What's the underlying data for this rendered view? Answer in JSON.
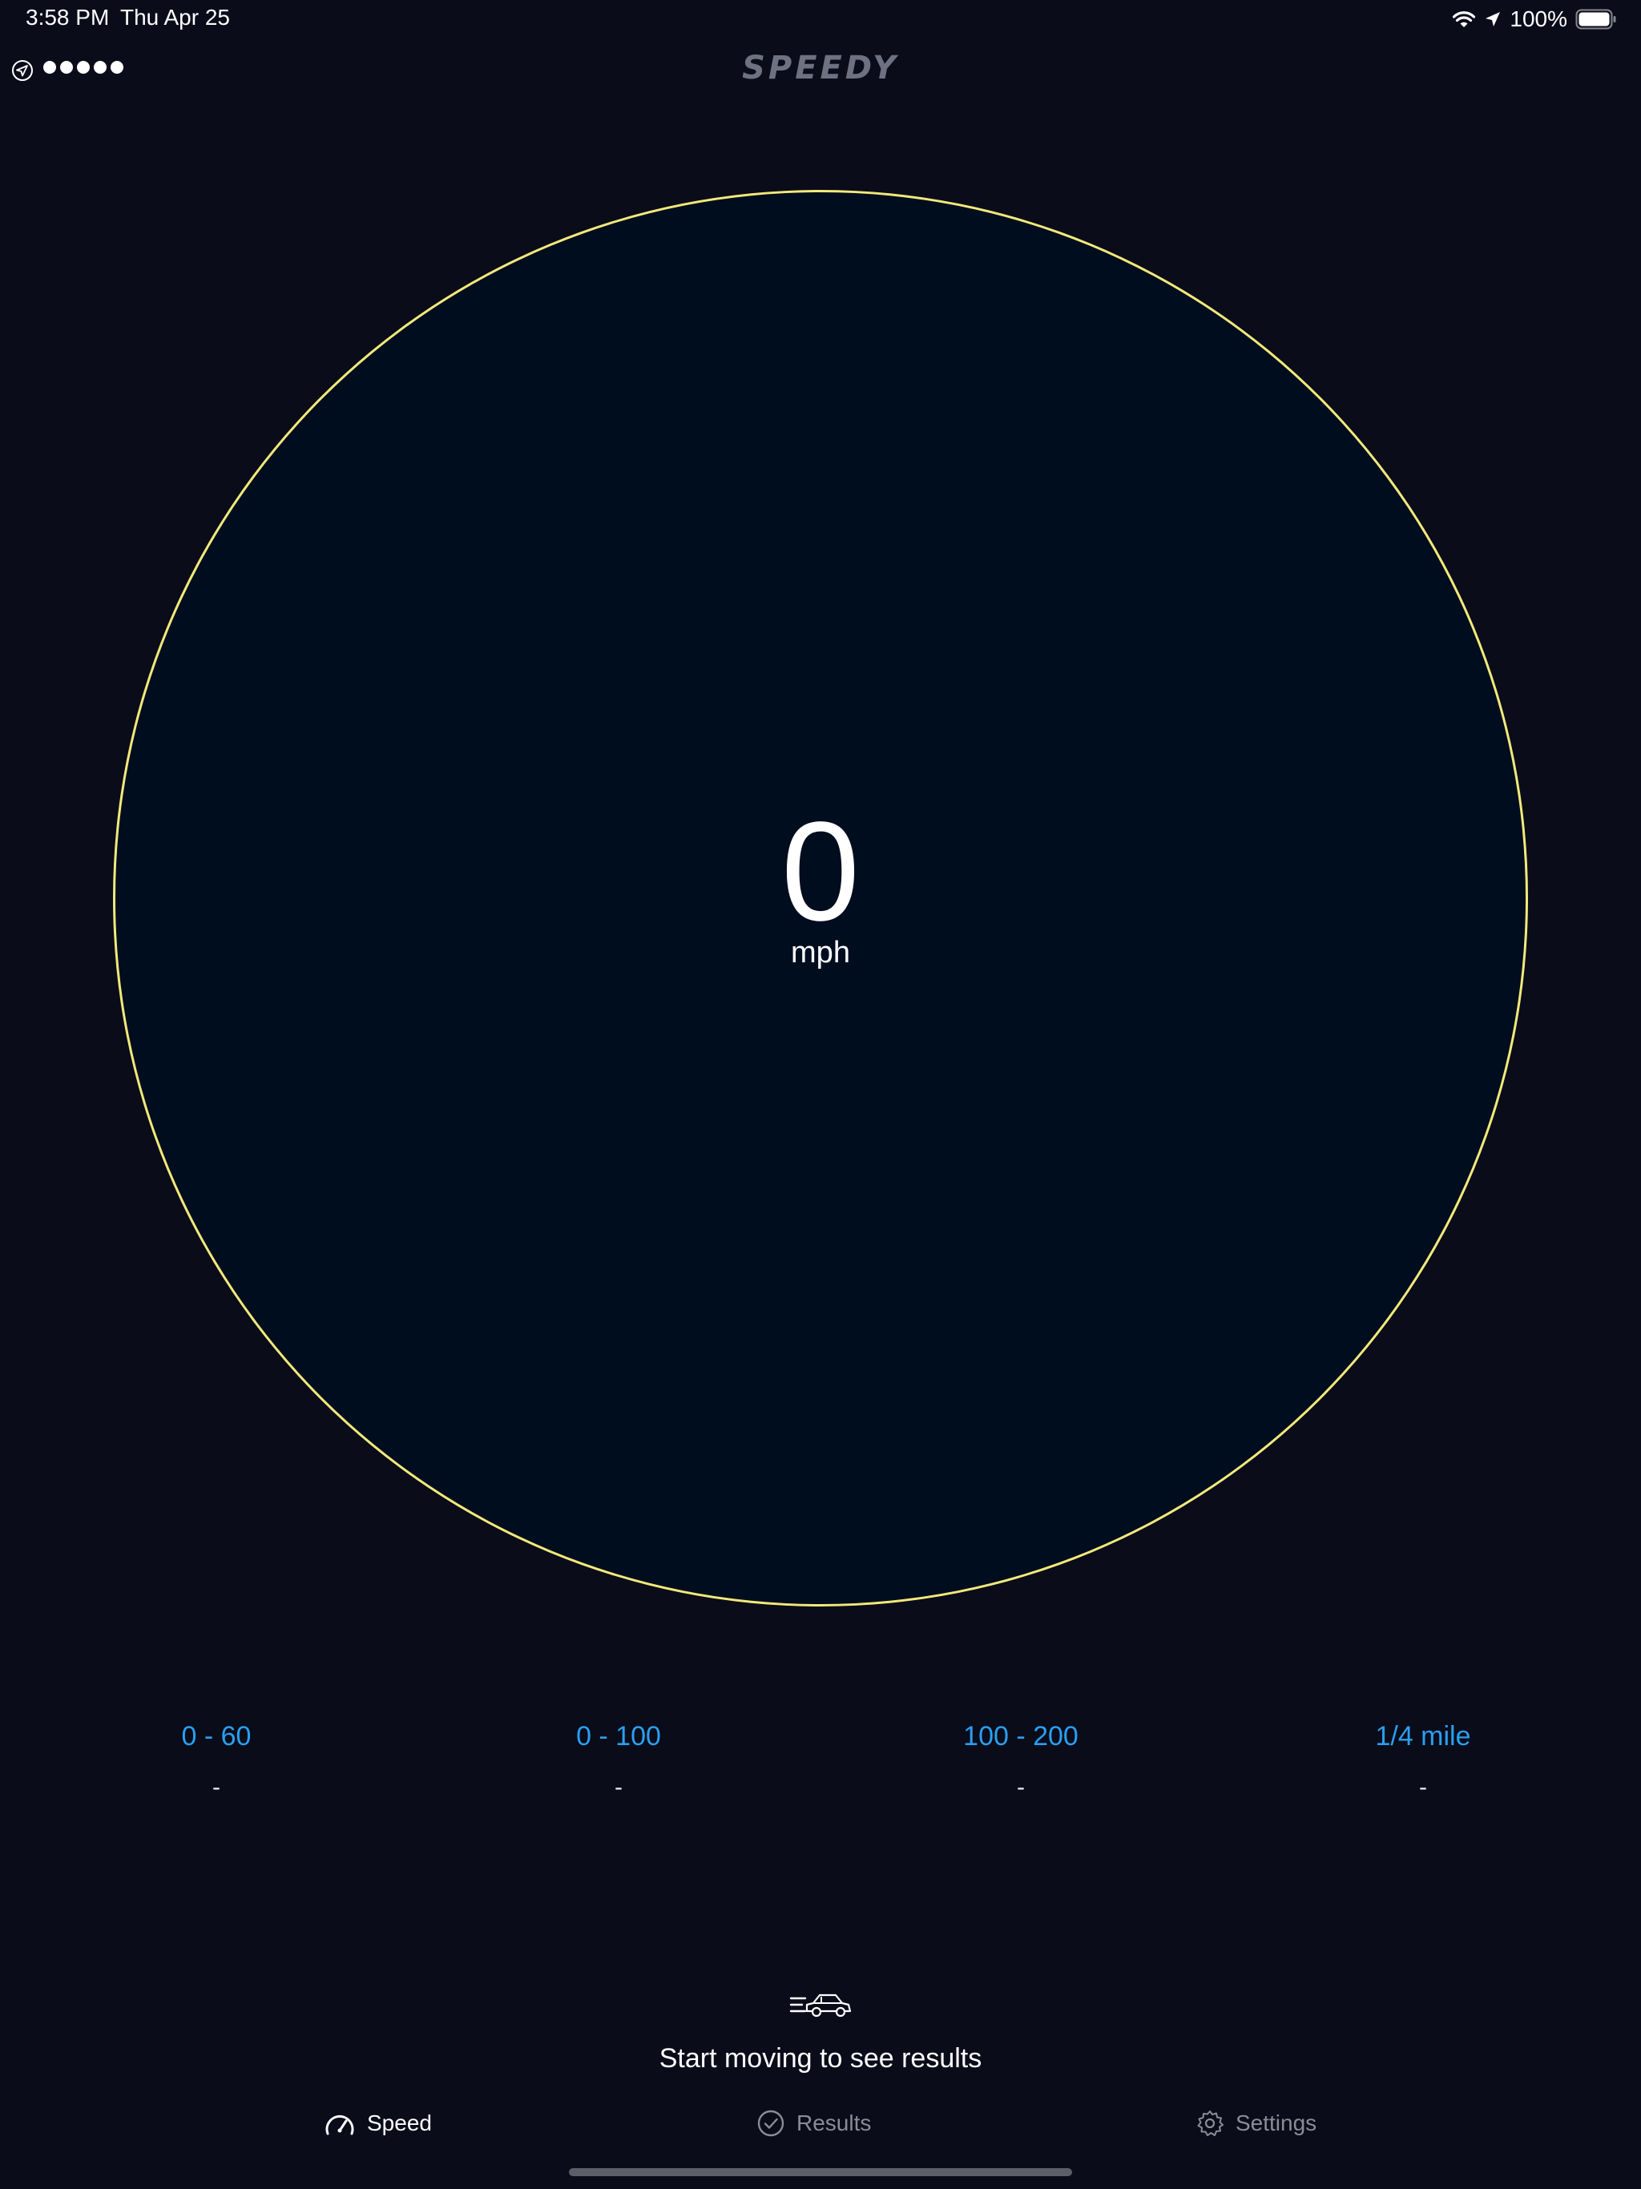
{
  "status_bar": {
    "time": "3:58 PM",
    "date": "Thu Apr 25",
    "battery": "100%",
    "icons": [
      "wifi-icon",
      "location-arrow-icon",
      "battery-icon"
    ]
  },
  "nav": {
    "title": "SPEEDY",
    "location_icon": "location-circle-icon",
    "signal_dots": 5
  },
  "gauge": {
    "speed": "0",
    "unit": "mph",
    "ring_color": "#f2e97a",
    "fill_color": "#000d1f"
  },
  "metrics": [
    {
      "label": "0 - 60",
      "value": "-"
    },
    {
      "label": "0 - 100",
      "value": "-"
    },
    {
      "label": "100 - 200",
      "value": "-"
    },
    {
      "label": "1/4 mile",
      "value": "-"
    }
  ],
  "hint": {
    "icon": "speeding-car-icon",
    "text": "Start moving to see results"
  },
  "tabs": [
    {
      "label": "Speed",
      "icon": "speedometer-icon",
      "active": true
    },
    {
      "label": "Results",
      "icon": "checkmark-circle-icon",
      "active": false
    },
    {
      "label": "Settings",
      "icon": "gear-icon",
      "active": false
    }
  ],
  "colors": {
    "background": "#0a0c1a",
    "accent": "#2a9ff0",
    "inactive_tab": "#8a8d96"
  }
}
